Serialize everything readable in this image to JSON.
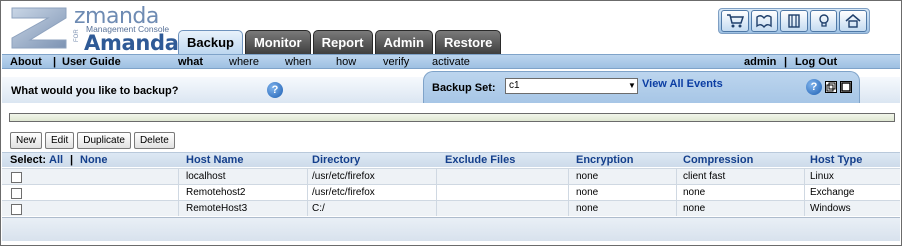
{
  "brand": {
    "zmanda": "zmanda",
    "console": "Management Console",
    "for": "FOR",
    "amanda": "Amanda"
  },
  "tabs": [
    {
      "label": "Backup",
      "active": true
    },
    {
      "label": "Monitor",
      "active": false
    },
    {
      "label": "Report",
      "active": false
    },
    {
      "label": "Admin",
      "active": false
    },
    {
      "label": "Restore",
      "active": false
    }
  ],
  "tool_icons": [
    "cart-icon",
    "book-icon",
    "binder-icon",
    "lightbulb-icon",
    "home-icon"
  ],
  "nav": {
    "about": "About",
    "sep1": "|",
    "user_guide": "User Guide",
    "steps": [
      "what",
      "where",
      "when",
      "how",
      "verify",
      "activate"
    ],
    "active_step": "what",
    "admin": "admin",
    "sep2": "|",
    "logout": "Log Out"
  },
  "question": "What would you like to backup?",
  "backup_set": {
    "label": "Backup Set:",
    "value": "c1",
    "link": "View All Events"
  },
  "progress": 0,
  "actions": [
    "New",
    "Edit",
    "Duplicate",
    "Delete"
  ],
  "table": {
    "select_label": "Select:",
    "select_all": "All",
    "select_sep": "|",
    "select_none": "None",
    "columns": [
      "Host Name",
      "Directory",
      "Exclude Files",
      "Encryption",
      "Compression",
      "Host Type"
    ],
    "rows": [
      {
        "host": "localhost",
        "directory": "/usr/etc/firefox",
        "exclude": "",
        "encryption": "none",
        "compression": "client fast",
        "type": "Linux"
      },
      {
        "host": "Remotehost2",
        "directory": "/usr/etc/firefox",
        "exclude": "",
        "encryption": "none",
        "compression": "none",
        "type": "Exchange"
      },
      {
        "host": "RemoteHost3",
        "directory": "C:/",
        "exclude": "",
        "encryption": "none",
        "compression": "none",
        "type": "Windows"
      }
    ]
  },
  "colors": {
    "accent": "#2f5a96",
    "nav_bar": "#a7c6e6",
    "link": "#0b3da3",
    "header_text": "#143f8c"
  }
}
